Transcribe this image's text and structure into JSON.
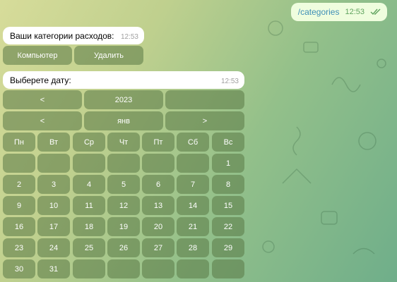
{
  "outgoing": {
    "text": "/categories",
    "time": "12:53"
  },
  "categories_msg": {
    "text": "Ваши категории расходов:",
    "time": "12:53"
  },
  "category_buttons": [
    "Компьютер",
    "Удалить"
  ],
  "date_msg": {
    "text": "Выберете дату:",
    "time": "12:53"
  },
  "calendar": {
    "year_row": [
      "<",
      "2023",
      ""
    ],
    "month_row": [
      "<",
      "янв",
      ">"
    ],
    "weekdays": [
      "Пн",
      "Вт",
      "Ср",
      "Чт",
      "Пт",
      "Сб",
      "Вс"
    ],
    "weeks": [
      [
        "",
        "",
        "",
        "",
        "",
        "",
        "1"
      ],
      [
        "2",
        "3",
        "4",
        "5",
        "6",
        "7",
        "8"
      ],
      [
        "9",
        "10",
        "11",
        "12",
        "13",
        "14",
        "15"
      ],
      [
        "16",
        "17",
        "18",
        "19",
        "20",
        "21",
        "22"
      ],
      [
        "23",
        "24",
        "25",
        "26",
        "27",
        "28",
        "29"
      ],
      [
        "30",
        "31",
        "",
        "",
        "",
        "",
        ""
      ]
    ]
  }
}
